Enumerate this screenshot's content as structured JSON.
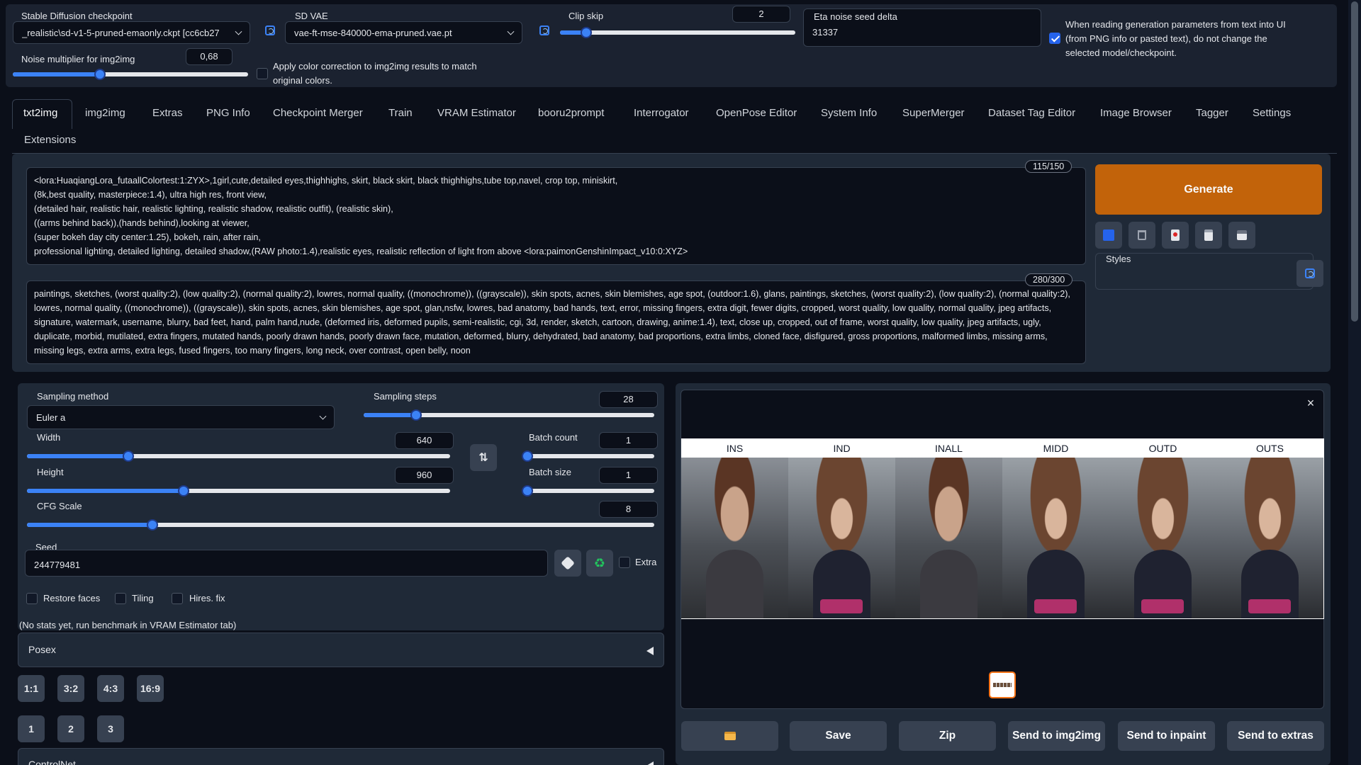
{
  "settings": {
    "checkpoint": {
      "label": "Stable Diffusion checkpoint",
      "value": "_realistic\\sd-v1-5-pruned-emaonly.ckpt [cc6cb27"
    },
    "vae": {
      "label": "SD VAE",
      "value": "vae-ft-mse-840000-ema-pruned.vae.pt"
    },
    "clip_skip": {
      "label": "Clip skip",
      "value": "2",
      "fraction": 0.11
    },
    "eta": {
      "label": "Eta noise seed delta",
      "value": "31337"
    },
    "keep_model": {
      "label": "When reading generation parameters from text into UI (from PNG info or pasted text), do not change the selected model/checkpoint.",
      "checked": true
    },
    "noise": {
      "label": "Noise multiplier for img2img",
      "value": "0,68",
      "fraction": 0.46
    },
    "color_correction": {
      "label": "Apply color correction to img2img results to match original colors.",
      "checked": false
    }
  },
  "tabs": [
    "txt2img",
    "img2img",
    "Extras",
    "PNG Info",
    "Checkpoint Merger",
    "Train",
    "VRAM Estimator",
    "booru2prompt",
    "Interrogator",
    "OpenPose Editor",
    "System Info",
    "SuperMerger",
    "Dataset Tag Editor",
    "Image Browser",
    "Tagger",
    "Settings",
    "Extensions"
  ],
  "active_tab": "txt2img",
  "prompt": {
    "counter": "115/150",
    "lines": [
      "<lora:HuaqiangLora_futaallColortest:1:ZYX>,1girl,cute,detailed eyes,thighhighs, skirt, black skirt, black thighhighs,tube top,navel, crop top, miniskirt,",
      "(8k,best quality, masterpiece:1.4), ultra high res, front view,",
      "(detailed hair, realistic hair, realistic lighting, realistic shadow, realistic outfit), (realistic skin),",
      "((arms behind back)),(hands behind),looking at viewer,",
      "(super bokeh day city center:1.25), bokeh, rain, after rain,",
      "professional lighting, detailed lighting, detailed shadow,(RAW photo:1.4),realistic eyes, realistic reflection of light from above <lora:paimonGenshinImpact_v10:0:XYZ>"
    ]
  },
  "negative": {
    "counter": "280/300",
    "text": "paintings, sketches, (worst quality:2), (low quality:2), (normal quality:2), lowres, normal quality, ((monochrome)), ((grayscale)), skin spots, acnes, skin blemishes, age spot, (outdoor:1.6), glans, paintings, sketches, (worst quality:2), (low quality:2), (normal quality:2), lowres, normal quality, ((monochrome)), ((grayscale)), skin spots, acnes, skin blemishes, age spot, glan,nsfw, lowres, bad anatomy, bad hands, text, error, missing fingers, extra digit, fewer digits, cropped, worst quality, low quality, normal quality, jpeg artifacts, signature, watermark, username, blurry, bad feet, hand, palm hand,nude, (deformed iris, deformed pupils, semi-realistic, cgi, 3d, render, sketch, cartoon, drawing, anime:1.4), text, close up, cropped, out of frame, worst quality, low quality, jpeg artifacts, ugly, duplicate, morbid, mutilated, extra fingers, mutated hands, poorly drawn hands, poorly drawn face, mutation, deformed, blurry, dehydrated, bad anatomy, bad proportions, extra limbs, cloned face, disfigured, gross proportions, malformed limbs, missing arms, missing legs, extra arms, extra legs, fused fingers, too many fingers, long neck, over contrast, open belly, noon"
  },
  "generate": {
    "label": "Generate",
    "color": "#c2630a"
  },
  "styles": {
    "label": "Styles",
    "value": ""
  },
  "params": {
    "sampling_method": {
      "label": "Sampling method",
      "value": "Euler a"
    },
    "sampling_steps": {
      "label": "Sampling steps",
      "value": "28",
      "fraction": 0.18
    },
    "width": {
      "label": "Width",
      "value": "640",
      "fraction": 0.29
    },
    "height": {
      "label": "Height",
      "value": "960",
      "fraction": 0.45
    },
    "batch_count": {
      "label": "Batch count",
      "value": "1",
      "fraction": 0.0
    },
    "batch_size": {
      "label": "Batch size",
      "value": "1",
      "fraction": 0.0
    },
    "cfg": {
      "label": "CFG Scale",
      "value": "8",
      "fraction": 0.24
    },
    "seed": {
      "label": "Seed",
      "value": "244779481"
    },
    "extra": {
      "label": "Extra",
      "checked": false
    },
    "restore_faces": {
      "label": "Restore faces",
      "checked": false
    },
    "tiling": {
      "label": "Tiling",
      "checked": false
    },
    "hires": {
      "label": "Hires. fix",
      "checked": false
    }
  },
  "stats_note": "(No stats yet, run benchmark in VRAM Estimator tab)",
  "posex": {
    "label": "Posex"
  },
  "ratio_buttons": [
    "1:1",
    "3:2",
    "4:3",
    "16:9"
  ],
  "count_buttons": [
    "1",
    "2",
    "3"
  ],
  "controlnet": {
    "label": "ControlNet"
  },
  "gallery": {
    "columns": [
      {
        "label": "INS",
        "subject": "woman"
      },
      {
        "label": "IND",
        "subject": "doll"
      },
      {
        "label": "INALL",
        "subject": "woman"
      },
      {
        "label": "MIDD",
        "subject": "doll"
      },
      {
        "label": "OUTD",
        "subject": "doll"
      },
      {
        "label": "OUTS",
        "subject": "doll"
      }
    ],
    "thumb_caption": ""
  },
  "output_buttons": [
    "Save",
    "Zip",
    "Send to img2img",
    "Send to inpaint",
    "Send to extras"
  ],
  "icons": {
    "refresh": "refresh-icon",
    "swap": "swap-icon",
    "dice": "dice-icon",
    "recycle": "recycle-icon",
    "folder": "folder-icon",
    "close": "close-icon"
  }
}
